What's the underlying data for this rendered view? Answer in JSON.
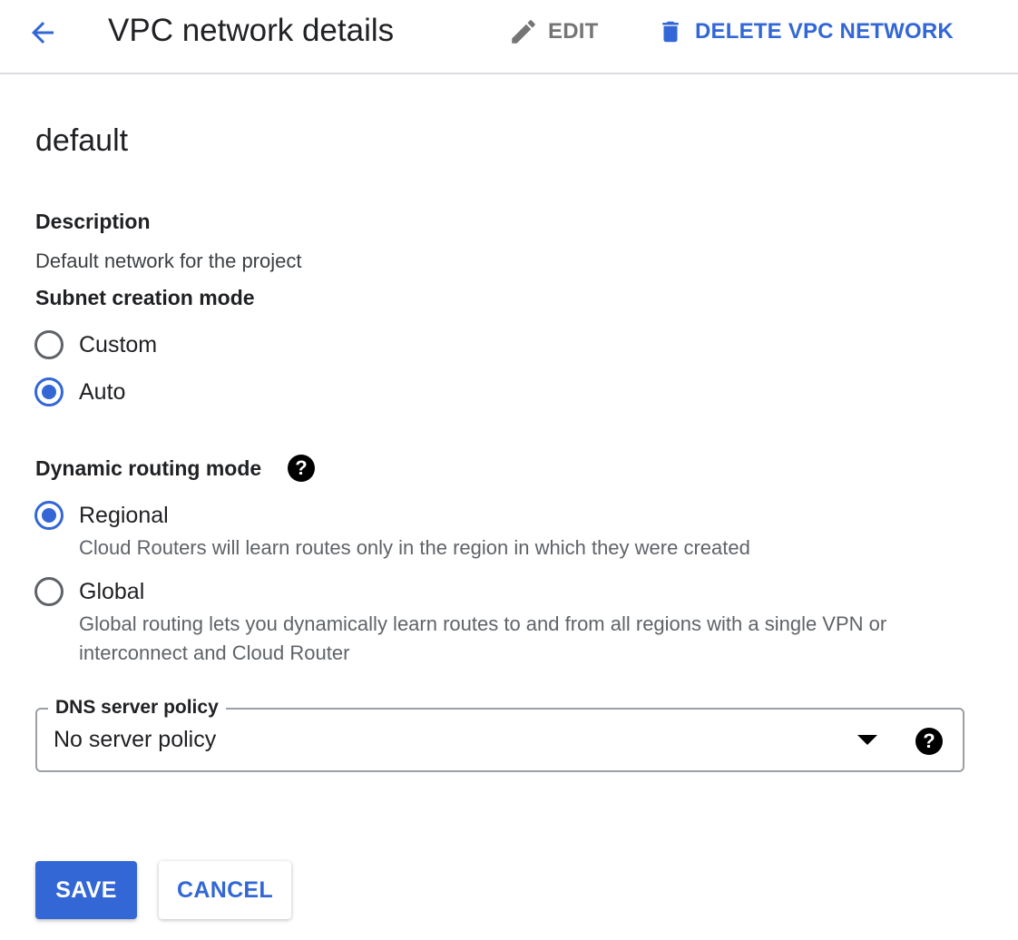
{
  "header": {
    "title": "VPC network details",
    "edit_label": "EDIT",
    "delete_label": "DELETE VPC NETWORK"
  },
  "network": {
    "name": "default"
  },
  "description": {
    "label": "Description",
    "value": "Default network for the project"
  },
  "subnet_mode": {
    "label": "Subnet creation mode",
    "options": [
      {
        "label": "Custom",
        "checked": false
      },
      {
        "label": "Auto",
        "checked": true
      }
    ]
  },
  "routing_mode": {
    "label": "Dynamic routing mode",
    "help_glyph": "?",
    "options": [
      {
        "label": "Regional",
        "checked": true,
        "help": "Cloud Routers will learn routes only in the region in which they were created"
      },
      {
        "label": "Global",
        "checked": false,
        "help": "Global routing lets you dynamically learn routes to and from all regions with a single VPN or interconnect and Cloud Router"
      }
    ]
  },
  "dns_policy": {
    "label": "DNS server policy",
    "value": "No server policy",
    "help_glyph": "?"
  },
  "actions": {
    "save_label": "SAVE",
    "cancel_label": "CANCEL"
  },
  "colors": {
    "accent": "#3367d6",
    "text": "#202124",
    "secondary_text": "#5f6368",
    "disabled": "#757575",
    "divider": "#dadce0"
  },
  "icons": {
    "back": "arrow-back-icon",
    "edit": "pencil-icon",
    "delete": "trash-icon",
    "help": "help-circle-icon",
    "dropdown": "caret-down-icon"
  }
}
